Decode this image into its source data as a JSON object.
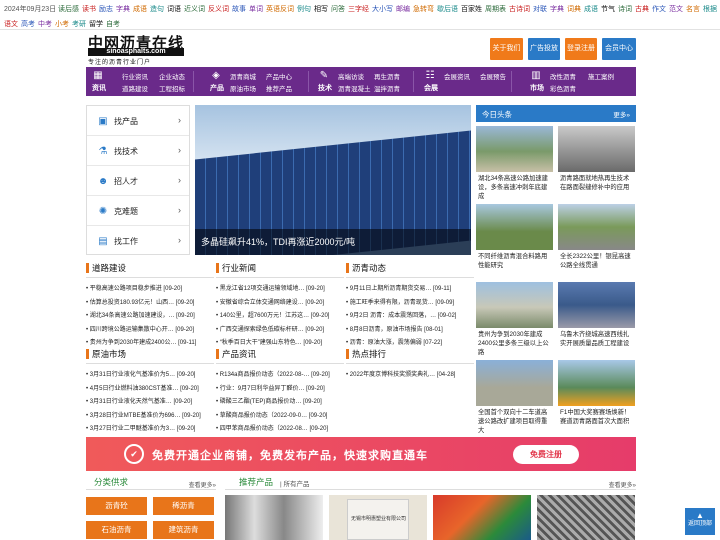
{
  "topbar": {
    "date": "2024年09月23日",
    "row1": [
      "读后感",
      "读书",
      "励志",
      "字典",
      "成语",
      "造句",
      "词语",
      "近义词",
      "反义词",
      "故事",
      "单词",
      "英语反词",
      "例句",
      "相写",
      "问答",
      "三字经",
      "大小写",
      "邮编",
      "急转弯",
      "歇后语",
      "百家姓",
      "周期表",
      "古诗词",
      "对联",
      "字典",
      "词典",
      "成语",
      "节气",
      "诗词",
      "古典",
      "作文",
      "范文",
      "名言",
      "根据",
      "文档",
      "诗词",
      "歌曲",
      "图书"
    ],
    "row2": [
      "语文",
      "高考",
      "中考",
      "小考",
      "考研",
      "留学",
      "自考"
    ]
  },
  "header": {
    "logo_cn": "中网沥青在线",
    "logo_en": "sinoasphalts.com",
    "slogan": "专注的沥青行业门户",
    "buttons": [
      "关于我们",
      "广告投放",
      "登录注册",
      "会员中心"
    ]
  },
  "nav": [
    {
      "cat": "资讯",
      "links": [
        "行业资讯",
        "企业动态",
        "道路建设",
        "工程招标"
      ]
    },
    {
      "cat": "产品",
      "links": [
        "沥青商城",
        "产品中心",
        "原油市场",
        "推荐产品"
      ]
    },
    {
      "cat": "技术",
      "links": [
        "高端访谈",
        "再生沥青",
        "沥青混凝土",
        "温拌沥青"
      ]
    },
    {
      "cat": "会展",
      "links": [
        "会展资讯",
        "会展预告"
      ]
    },
    {
      "cat": "市场",
      "links": [
        "改性沥青",
        "施工案例",
        "彩色沥青"
      ]
    }
  ],
  "left_menu": [
    "找产品",
    "找技术",
    "招人才",
    "克难题",
    "找工作"
  ],
  "banner": {
    "caption": "多晶硅飙升41%，TDI再涨近2000元/吨"
  },
  "headlines": {
    "title": "今日头条",
    "more": "更多»",
    "items": [
      "湖北34条高速公路加速建设，多条高速冲刺年底建成",
      "沥青路面就地热再生技术在路面裂缝修补中的应用",
      "不同纤维沥青混合料路用性能研究",
      "全长2322公里！银昆高速公路全线贯通",
      "贵州为争到2030年建成2400公里多条三级以上公路",
      "乌鲁木齐绕城高速西线扎实开展质量品质工程建设",
      "全国首个双向十二车道高速公路改扩建项目取得重大",
      "F1中国大奖赛赛场焕新！赛道沥青路面首次大面积"
    ]
  },
  "road": {
    "title": "道路建设",
    "items": [
      {
        "t": "平稳高速公路项目稳步推进",
        "d": "[09-20]"
      },
      {
        "t": "估算总投资180.93亿元！山西…",
        "d": "[09-20]"
      },
      {
        "t": "湖北34条高速公路加速建设，…",
        "d": "[09-20]"
      },
      {
        "t": "四川跨境公路运输集散中心开…",
        "d": "[09-20]"
      },
      {
        "t": "贵州为争到2030年建成2400公…",
        "d": "[09-11]"
      }
    ]
  },
  "industry": {
    "title": "行业新闻",
    "items": [
      {
        "t": "黑龙江省12项交通运输领域地…",
        "d": "[09-20]"
      },
      {
        "t": "安徽省综合立体交通网络建设…",
        "d": "[09-20]"
      },
      {
        "t": "140公里，超7600万元！江苏这…",
        "d": "[09-20]"
      },
      {
        "t": "广西交通探索绿色低碳标杆研…",
        "d": "[09-20]"
      },
      {
        "t": "“秋季百日大干”建强山东特色…",
        "d": "[09-20]"
      }
    ]
  },
  "asphalt": {
    "title": "沥青动态",
    "items": [
      {
        "t": "9月11日上期所沥青期货交易…",
        "d": "[09-11]"
      },
      {
        "t": "施工旺季来得有限，沥青现货…",
        "d": "[09-09]"
      },
      {
        "t": "9月2日 沥青：成本震荡回落，…",
        "d": "[09-02]"
      },
      {
        "t": "8月8日沥青，原油市场报告",
        "d": "[08-01]"
      },
      {
        "t": "沥青：原油大涨，震荡偏弱",
        "d": "[07-22]"
      }
    ]
  },
  "crude": {
    "title": "原油市场",
    "items": [
      {
        "t": "3月31日行业液化气基准价为5…",
        "d": "[09-20]"
      },
      {
        "t": "4月5日行业燃料油380CST基准…",
        "d": "[09-20]"
      },
      {
        "t": "3月31日行业液化天然气基准…",
        "d": "[09-20]"
      },
      {
        "t": "3月28日行业MTBE基准价为696…",
        "d": "[09-20]"
      },
      {
        "t": "3月27日行业二甲醚基准价为3…",
        "d": "[09-20]"
      }
    ]
  },
  "products": {
    "title": "产品资讯",
    "items": [
      {
        "t": "R134a商品报价动态（2022-08-…",
        "d": "[09-20]"
      },
      {
        "t": "行业：9月7日利华益异丁醛价…",
        "d": "[09-20]"
      },
      {
        "t": "磷酸三乙酯(TEP)商品报价动…",
        "d": "[09-20]"
      },
      {
        "t": "草酸商品报价动态（2022-09-0…",
        "d": "[09-20]"
      },
      {
        "t": "四甲苯商品报价动态（2022-08…",
        "d": "[09-20]"
      }
    ]
  },
  "hot": {
    "title": "热点排行",
    "items": [
      {
        "t": "2022年度京博科技奖颁奖典礼…",
        "d": "[04-28]"
      }
    ]
  },
  "ad": {
    "text": "免费开通企业商铺，免费发布产品，快速求购直通车",
    "button": "免费注册"
  },
  "cats": {
    "title": "分类供求",
    "more": "查看更多»",
    "items": [
      "沥青砼",
      "稀沥青",
      "石油沥青",
      "建筑沥青"
    ]
  },
  "prods": {
    "title": "推荐产品",
    "sub": "| 所有产品",
    "more": "查看更多»",
    "bag_text": "无锡市明惠塑业有限公司"
  },
  "backtop": "返回顶部",
  "colors": {
    "nav": "#6a2a8a",
    "accent": "#e8751a",
    "blue": "#2a7ac7",
    "ad": "#f05a5a"
  }
}
